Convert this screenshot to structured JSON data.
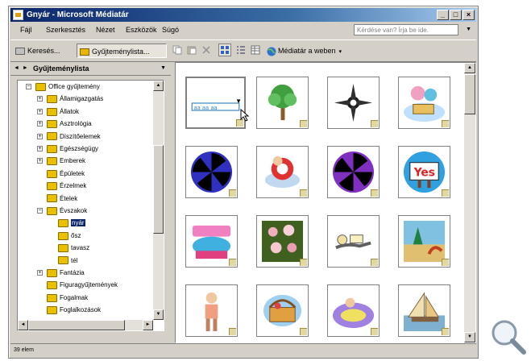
{
  "window": {
    "title": "Gnyár - Microsoft Médiatár",
    "minimize": "_",
    "maximize": "□",
    "close": "×"
  },
  "menu": {
    "items": [
      "Fájl",
      "Szerkesztés",
      "Nézet",
      "Eszközök",
      "Súgó"
    ],
    "help_placeholder": "Kérdése van? Írja be ide."
  },
  "toolbar": {
    "search_label": "Keresés...",
    "collections_label": "Gyűjteménylista...",
    "online_label": "Médiatár a weben"
  },
  "left_pane": {
    "header": "Gyűjteménylista",
    "tree": [
      {
        "label": "Office gyűjtemény",
        "level": 0,
        "expander": "−"
      },
      {
        "label": "Államigazgatás",
        "level": 1,
        "expander": "+"
      },
      {
        "label": "Állatok",
        "level": 1,
        "expander": "+"
      },
      {
        "label": "Asztrológia",
        "level": 1,
        "expander": "+"
      },
      {
        "label": "Díszítőelemek",
        "level": 1,
        "expander": "+"
      },
      {
        "label": "Egészségügy",
        "level": 1,
        "expander": "+"
      },
      {
        "label": "Emberek",
        "level": 1,
        "expander": "+"
      },
      {
        "label": "Épületek",
        "level": 1,
        "expander": ""
      },
      {
        "label": "Érzelmek",
        "level": 1,
        "expander": ""
      },
      {
        "label": "Ételek",
        "level": 1,
        "expander": ""
      },
      {
        "label": "Évszakok",
        "level": 1,
        "expander": "−"
      },
      {
        "label": "nyár",
        "level": 2,
        "expander": "",
        "selected": true
      },
      {
        "label": "ősz",
        "level": 2,
        "expander": ""
      },
      {
        "label": "tavasz",
        "level": 2,
        "expander": ""
      },
      {
        "label": "tél",
        "level": 2,
        "expander": ""
      },
      {
        "label": "Fantázia",
        "level": 1,
        "expander": "+"
      },
      {
        "label": "Figuragyűjtemények",
        "level": 1,
        "expander": ""
      },
      {
        "label": "Fogalmak",
        "level": 1,
        "expander": ""
      },
      {
        "label": "Foglalkozások",
        "level": 1,
        "expander": ""
      }
    ]
  },
  "clips": [
    {
      "name": "border-divider"
    },
    {
      "name": "tree-clipart"
    },
    {
      "name": "sun-ornament"
    },
    {
      "name": "beach-picnic"
    },
    {
      "name": "blue-pinwheel"
    },
    {
      "name": "swimmer-ring"
    },
    {
      "name": "purple-pinwheel"
    },
    {
      "name": "yes-sign"
    },
    {
      "name": "summer-banner"
    },
    {
      "name": "flower-collage"
    },
    {
      "name": "reclining-person"
    },
    {
      "name": "beach-scene"
    },
    {
      "name": "standing-person"
    },
    {
      "name": "picnic-basket"
    },
    {
      "name": "pool-float"
    },
    {
      "name": "sailboat"
    }
  ],
  "status": "39 elem",
  "colors": {
    "selection": "#0a246a",
    "folder": "#e8c000",
    "face": "#d4d0c8"
  }
}
